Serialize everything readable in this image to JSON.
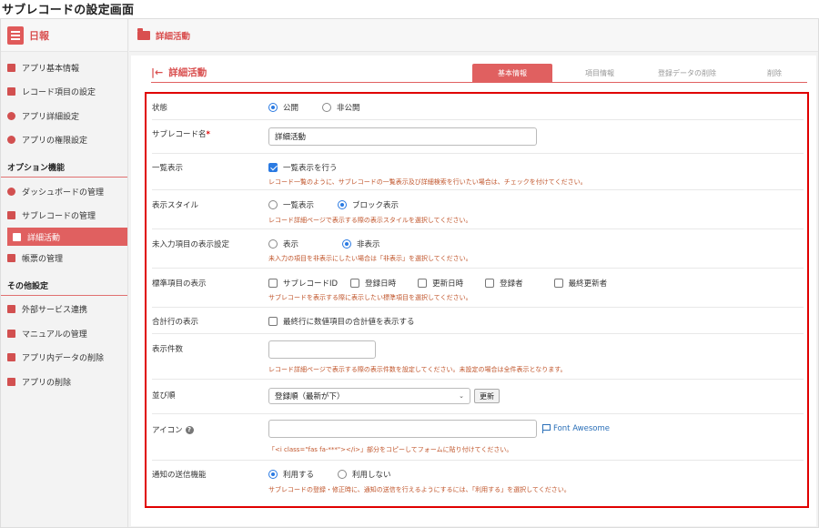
{
  "caption": "サブレコードの設定画面",
  "sidebar": {
    "brand": "日報",
    "items": [
      {
        "label": "アプリ基本情報",
        "icon": "info-icon"
      },
      {
        "label": "レコード項目の設定",
        "icon": "list-icon"
      },
      {
        "label": "アプリ詳細設定",
        "icon": "gear-icon"
      },
      {
        "label": "アプリの権限設定",
        "icon": "users-icon"
      }
    ],
    "option_heading": "オプション機能",
    "option_items": [
      {
        "label": "ダッシュボードの管理",
        "icon": "dashboard-icon"
      },
      {
        "label": "サブレコードの管理",
        "icon": "layers-icon"
      },
      {
        "label": "詳細活動",
        "icon": "folder-icon",
        "active": true
      },
      {
        "label": "帳票の管理",
        "icon": "document-icon"
      }
    ],
    "other_heading": "その他設定",
    "other_items": [
      {
        "label": "外部サービス連携",
        "icon": "plug-icon"
      },
      {
        "label": "マニュアルの管理",
        "icon": "book-icon"
      },
      {
        "label": "アプリ内データの削除",
        "icon": "eraser-icon"
      },
      {
        "label": "アプリの削除",
        "icon": "trash-icon"
      }
    ]
  },
  "topbar": {
    "title": "詳細活動"
  },
  "heading": {
    "title": "詳細活動"
  },
  "tabs": [
    {
      "label": "基本情報",
      "active": true
    },
    {
      "label": "項目情報"
    },
    {
      "label": "登録データの削除"
    },
    {
      "label": "削除"
    }
  ],
  "form": {
    "status": {
      "label": "状態",
      "options": [
        "公開",
        "非公開"
      ],
      "selected": "公開"
    },
    "name": {
      "label": "サブレコード名",
      "required_mark": "*",
      "value": "詳細活動"
    },
    "list_display": {
      "label": "一覧表示",
      "checkbox_label": "一覧表示を行う",
      "checked": true,
      "hint": "レコード一覧のように、サブレコードの一覧表示及び詳細検索を行いたい場合は、チェックを付けてください。"
    },
    "display_style": {
      "label": "表示スタイル",
      "options": [
        "一覧表示",
        "ブロック表示"
      ],
      "selected": "ブロック表示",
      "hint": "レコード詳細ページで表示する際の表示スタイルを選択してください。"
    },
    "empty_display": {
      "label": "未入力項目の表示設定",
      "options": [
        "表示",
        "非表示"
      ],
      "selected": "非表示",
      "hint": "未入力の項目を非表示にしたい場合は「非表示」を選択してください。"
    },
    "standard_fields": {
      "label": "標準項目の表示",
      "options": [
        "サブレコードID",
        "登録日時",
        "更新日時",
        "登録者",
        "最終更新者"
      ],
      "hint": "サブレコードを表示する際に表示したい標準項目を選択してください。"
    },
    "total_row": {
      "label": "合計行の表示",
      "checkbox_label": "最終行に数値項目の合計値を表示する",
      "checked": false
    },
    "count": {
      "label": "表示件数",
      "value": "",
      "hint": "レコード詳細ページで表示する際の表示件数を設定してください。未設定の場合は全件表示となります。"
    },
    "sort": {
      "label": "並び順",
      "selected": "登録順（最新が下）",
      "button": "更新"
    },
    "icon": {
      "label": "アイコン",
      "help": "?",
      "value": "",
      "link": "Font Awesome",
      "hint": "「<i class=\"fas fa-***\"></i>」部分をコピーしてフォームに貼り付けてください。"
    },
    "notify": {
      "label": "通知の送信機能",
      "options": [
        "利用する",
        "利用しない"
      ],
      "selected": "利用する",
      "hint": "サブレコードの登録・修正時に、通知の送信を行えるようにするには、「利用する」を選択してください。"
    }
  }
}
